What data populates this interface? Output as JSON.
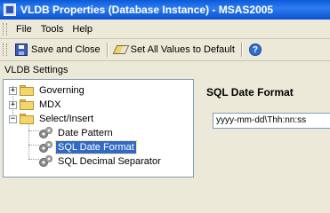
{
  "window": {
    "title": "VLDB Properties (Database Instance) - MSAS2005"
  },
  "menu": {
    "items": [
      "File",
      "Tools",
      "Help"
    ]
  },
  "toolbar": {
    "save_close": "Save and Close",
    "set_all": "Set All Values to Default",
    "help_icon": "help-icon"
  },
  "settings_label": "VLDB Settings",
  "tree": {
    "nodes": [
      {
        "label": "Governing",
        "expander": "+"
      },
      {
        "label": "MDX",
        "expander": "+"
      },
      {
        "label": "Select/Insert",
        "expander": "−"
      },
      {
        "label": "Date Pattern"
      },
      {
        "label": "SQL Date Format"
      },
      {
        "label": "SQL Decimal Separator"
      }
    ]
  },
  "property": {
    "title": "SQL Date Format",
    "value": "yyyy-mm-dd\\Thh:nn:ss"
  },
  "colors": {
    "title_bar": "#0a5ad8",
    "selection": "#316ac5",
    "background": "#ece9d8"
  }
}
